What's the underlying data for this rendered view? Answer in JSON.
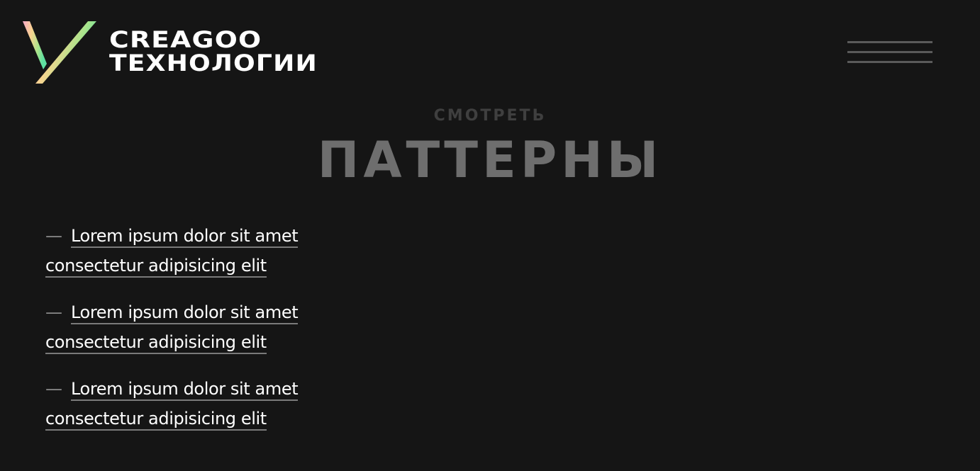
{
  "header": {
    "logo_line_1": "CREAGOO",
    "logo_line_2": "ТЕХНОЛОГИИ",
    "logo_colors": [
      "#f7a9c9",
      "#f8d48f",
      "#a8e58c",
      "#5fe0a0"
    ],
    "menu_icon": "hamburger-menu-icon"
  },
  "hero": {
    "kicker": "СМОТРЕТЬ",
    "title": "ПАТТЕРНЫ"
  },
  "links": [
    {
      "dash": "—",
      "text": "Lorem ipsum dolor sit amet consectetur adipisicing elit"
    },
    {
      "dash": "—",
      "text": "Lorem ipsum dolor sit amet consectetur adipisicing elit"
    },
    {
      "dash": "—",
      "text": "Lorem ipsum dolor sit amet consectetur adipisicing elit"
    }
  ]
}
